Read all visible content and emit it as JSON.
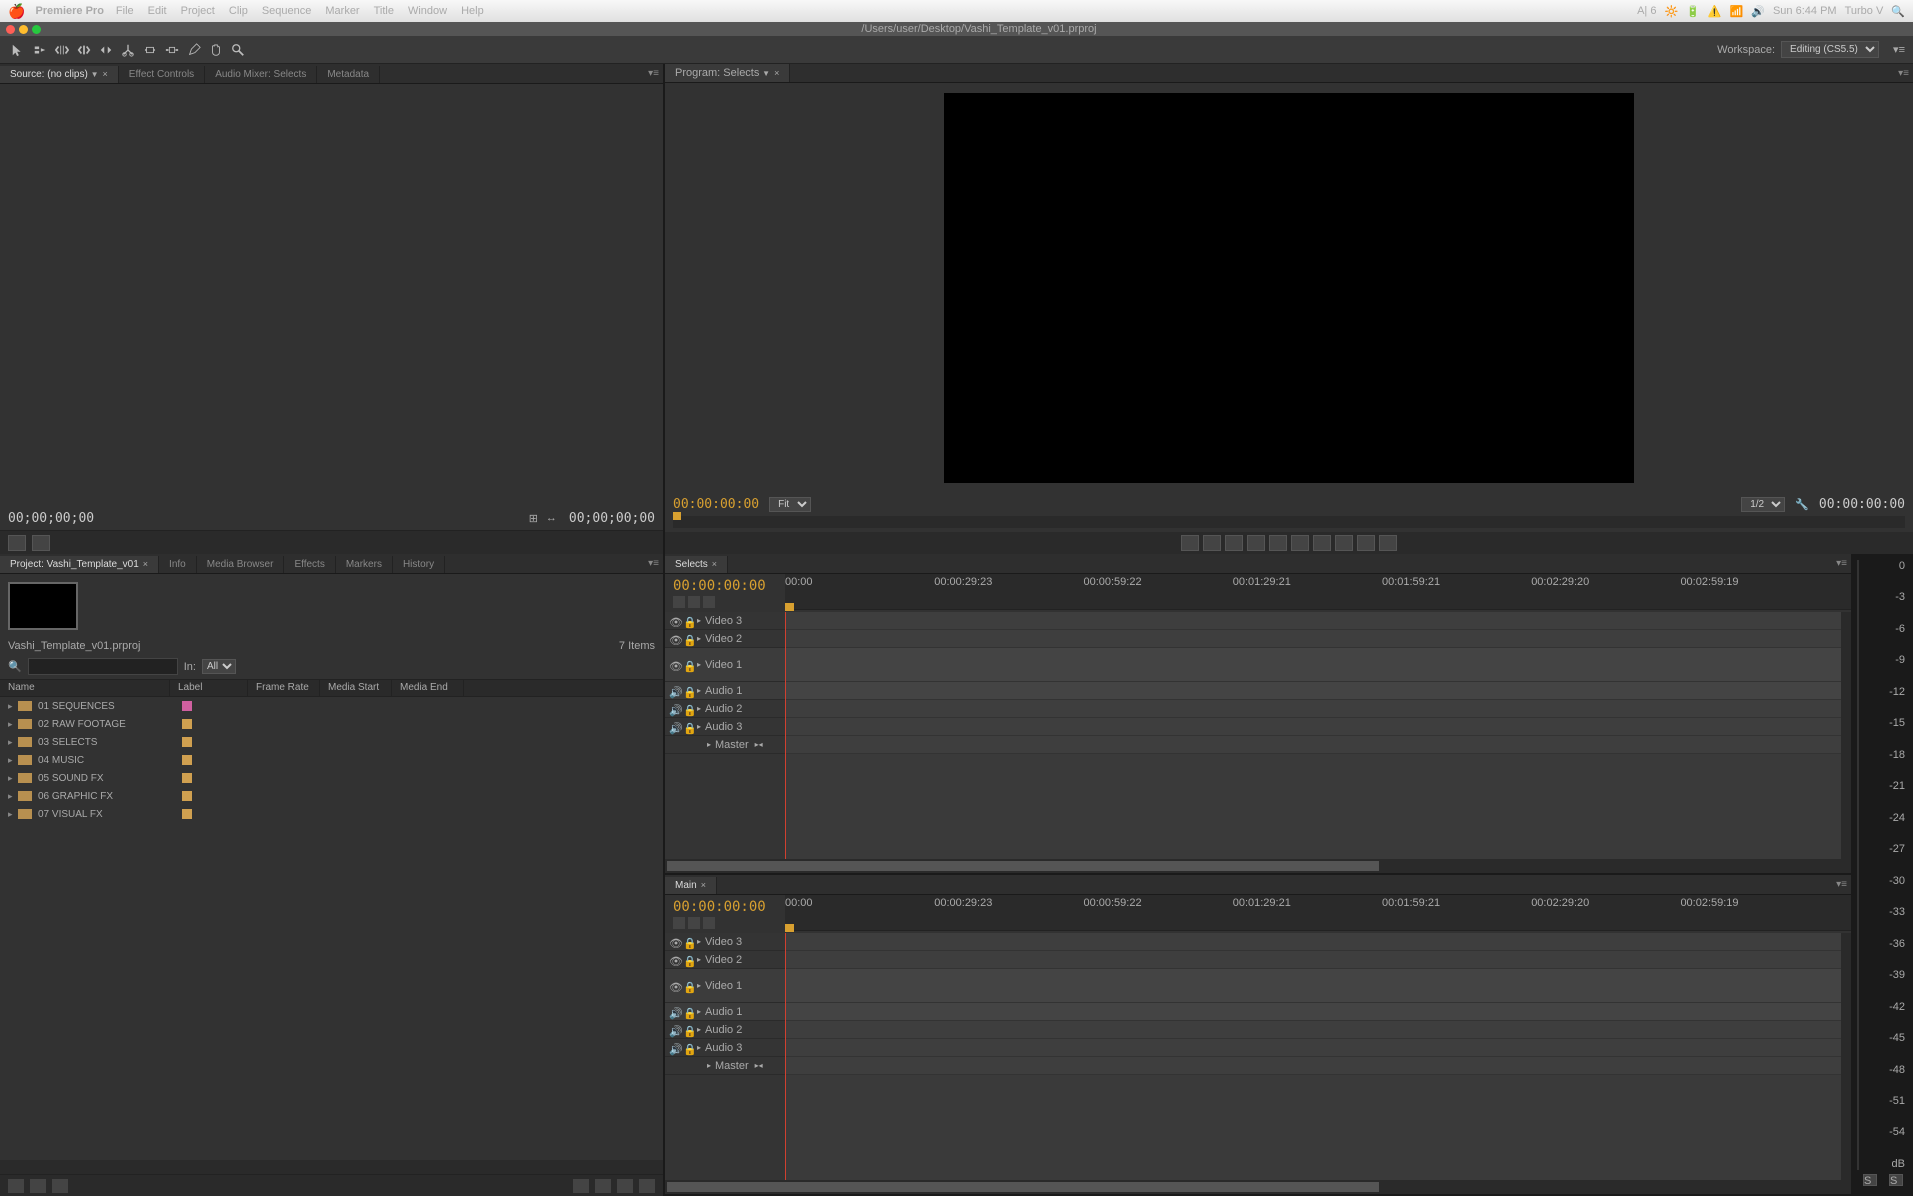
{
  "menubar": {
    "app": "Premiere Pro",
    "items": [
      "File",
      "Edit",
      "Project",
      "Clip",
      "Sequence",
      "Marker",
      "Title",
      "Window",
      "Help"
    ],
    "right": {
      "adobe": "A| 6",
      "clock": "Sun 6:44 PM",
      "user": "Turbo V"
    }
  },
  "titlebar": {
    "path": "/Users/user/Desktop/Vashi_Template_v01.prproj"
  },
  "toolbar": {
    "workspace_label": "Workspace:",
    "workspace_value": "Editing (CS5.5)"
  },
  "source_panel": {
    "tabs": [
      {
        "label": "Source: (no clips)",
        "active": true
      },
      {
        "label": "Effect Controls"
      },
      {
        "label": "Audio Mixer: Selects"
      },
      {
        "label": "Metadata"
      }
    ],
    "tc_left": "00;00;00;00",
    "tc_right": "00;00;00;00"
  },
  "program_panel": {
    "tab": "Program: Selects",
    "tc_left": "00:00:00:00",
    "fit": "Fit",
    "quality": "1/2",
    "tc_right": "00:00:00:00"
  },
  "project_panel": {
    "tabs": [
      {
        "label": "Project: Vashi_Template_v01",
        "active": true
      },
      {
        "label": "Info"
      },
      {
        "label": "Media Browser"
      },
      {
        "label": "Effects"
      },
      {
        "label": "Markers"
      },
      {
        "label": "History"
      }
    ],
    "filename": "Vashi_Template_v01.prproj",
    "items_count": "7 Items",
    "search_placeholder": "",
    "in_label": "In:",
    "in_value": "All",
    "columns": [
      "Name",
      "Label",
      "Frame Rate",
      "Media Start",
      "Media End"
    ],
    "bins": [
      {
        "name": "01 SEQUENCES",
        "color": "#d060a0"
      },
      {
        "name": "02 RAW FOOTAGE",
        "color": "#d0a050"
      },
      {
        "name": "03 SELECTS",
        "color": "#d0a050"
      },
      {
        "name": "04 MUSIC",
        "color": "#d0a050"
      },
      {
        "name": "05 SOUND FX",
        "color": "#d0a050"
      },
      {
        "name": "06 GRAPHIC FX",
        "color": "#d0a050"
      },
      {
        "name": "07 VISUAL FX",
        "color": "#d0a050"
      }
    ]
  },
  "timelines": [
    {
      "tab": "Selects",
      "tc": "00:00:00:00",
      "ruler": [
        "00:00",
        "00:00:29:23",
        "00:00:59:22",
        "00:01:29:21",
        "00:01:59:21",
        "00:02:29:20",
        "00:02:59:19"
      ],
      "video_tracks": [
        "Video 3",
        "Video 2",
        "Video 1"
      ],
      "audio_tracks": [
        "Audio 1",
        "Audio 2",
        "Audio 3"
      ],
      "master": "Master"
    },
    {
      "tab": "Main",
      "tc": "00:00:00:00",
      "ruler": [
        "00:00",
        "00:00:29:23",
        "00:00:59:22",
        "00:01:29:21",
        "00:01:59:21",
        "00:02:29:20",
        "00:02:59:19"
      ],
      "video_tracks": [
        "Video 3",
        "Video 2",
        "Video 1"
      ],
      "audio_tracks": [
        "Audio 1",
        "Audio 2",
        "Audio 3"
      ],
      "master": "Master"
    }
  ],
  "meters": {
    "scale": [
      "0",
      "-3",
      "-6",
      "-9",
      "-12",
      "-15",
      "-18",
      "-21",
      "-24",
      "-27",
      "-30",
      "-33",
      "-36",
      "-39",
      "-42",
      "-45",
      "-48",
      "-51",
      "-54",
      "dB"
    ],
    "solo": "S"
  }
}
